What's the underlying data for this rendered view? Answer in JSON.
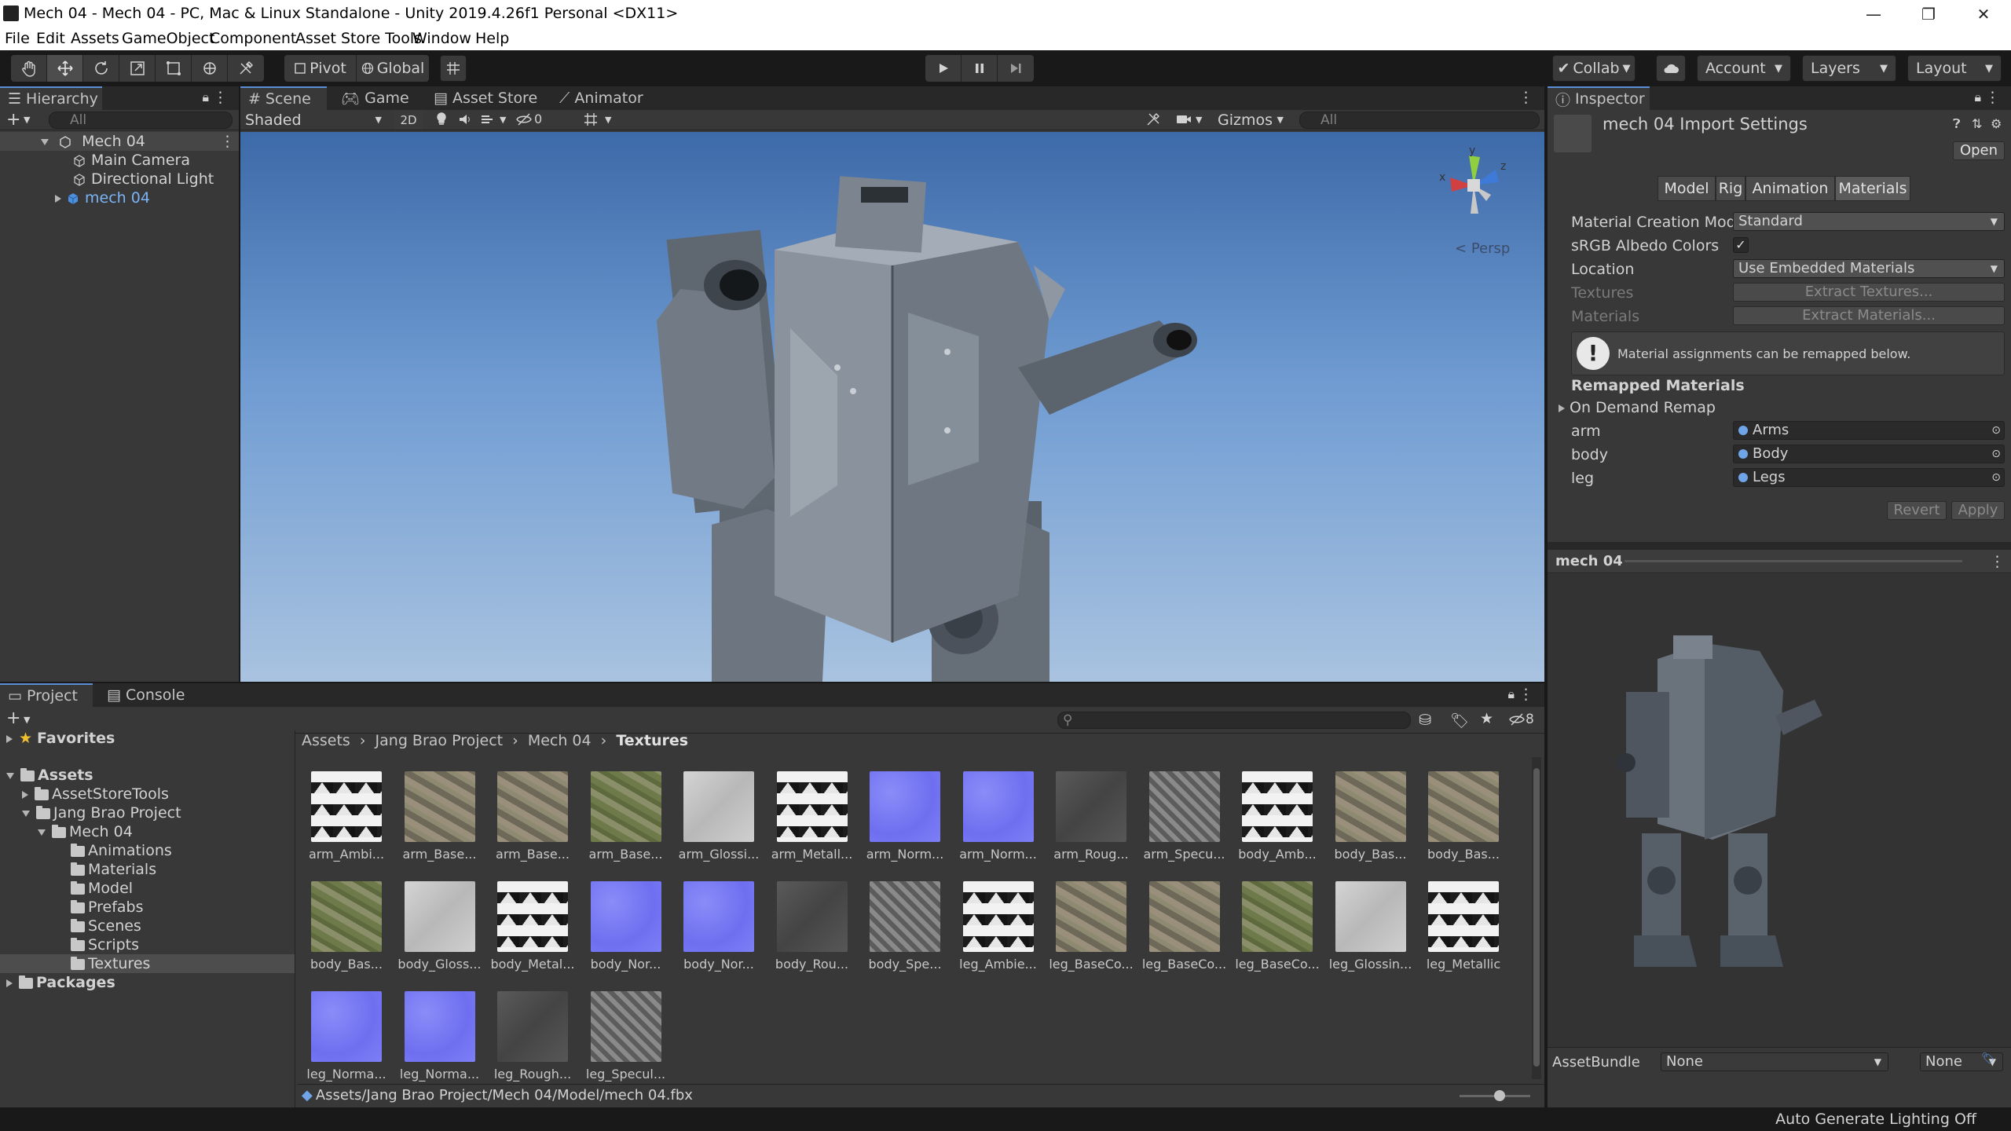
{
  "window": {
    "title": "Mech 04 - Mech 04 - PC, Mac & Linux Standalone - Unity 2019.4.26f1 Personal <DX11>",
    "minimize": "—",
    "maximize": "❐",
    "close": "✕"
  },
  "menu": [
    "File",
    "Edit",
    "Assets",
    "GameObject",
    "Component",
    "Asset Store Tools",
    "Window",
    "Help"
  ],
  "toolbar": {
    "pivot": "Pivot",
    "global": "Global",
    "collab": "Collab",
    "account": "Account",
    "layers": "Layers",
    "layout": "Layout"
  },
  "hierarchy": {
    "tab": "Hierarchy",
    "search_placeholder": "All",
    "scene": "Mech 04",
    "items": [
      "Main Camera",
      "Directional Light",
      "mech 04"
    ]
  },
  "scene_view": {
    "tabs": [
      "Scene",
      "Game",
      "Asset Store",
      "Animator"
    ],
    "shading": "Shaded",
    "mode_2d": "2D",
    "hidden_count": "0",
    "gizmos": "Gizmos",
    "search_placeholder": "All",
    "persp": "Persp",
    "axis_x": "x",
    "axis_y": "y",
    "axis_z": "z"
  },
  "inspector": {
    "tab": "Inspector",
    "title": "mech 04 Import Settings",
    "open_button": "Open",
    "tabs": [
      "Model",
      "Rig",
      "Animation",
      "Materials"
    ],
    "active_tab": "Materials",
    "fields": {
      "material_creation_mode_label": "Material Creation Mode",
      "material_creation_mode_value": "Standard",
      "srgb_label": "sRGB Albedo Colors",
      "srgb_checked": true,
      "location_label": "Location",
      "location_value": "Use Embedded Materials",
      "textures_label": "Textures",
      "extract_textures": "Extract Textures...",
      "materials_label": "Materials",
      "extract_materials": "Extract Materials..."
    },
    "info_message": "Material assignments can be remapped below.",
    "remapped_header": "Remapped Materials",
    "on_demand_remap": "On Demand Remap",
    "remaps": [
      {
        "name": "arm",
        "value": "Arms"
      },
      {
        "name": "body",
        "value": "Body"
      },
      {
        "name": "leg",
        "value": "Legs"
      }
    ],
    "revert": "Revert",
    "apply": "Apply",
    "preview_title": "mech 04",
    "assetbundle_label": "AssetBundle",
    "assetbundle_value": "None",
    "assetbundle_variant": "None"
  },
  "project": {
    "tabs": [
      "Project",
      "Console"
    ],
    "hidden_count": "8",
    "tree": {
      "favorites": "Favorites",
      "assets": "Assets",
      "assetstoretools": "AssetStoreTools",
      "jang_brao": "Jang Brao Project",
      "mech04": "Mech 04",
      "subfolders": [
        "Animations",
        "Materials",
        "Model",
        "Prefabs",
        "Scenes",
        "Scripts",
        "Textures"
      ],
      "packages": "Packages"
    },
    "breadcrumb": [
      "Assets",
      "Jang Brao Project",
      "Mech 04",
      "Textures"
    ],
    "files": [
      "arm_Ambi...",
      "arm_Base...",
      "arm_Base...",
      "arm_Base...",
      "arm_Glossi...",
      "arm_Metall...",
      "arm_Norm...",
      "arm_Norm...",
      "arm_Roug...",
      "arm_Specu...",
      "body_Amb...",
      "body_Bas...",
      "body_Bas...",
      "body_Bas...",
      "body_Gloss...",
      "body_Metal...",
      "body_Nor...",
      "body_Nor...",
      "body_Rou...",
      "body_Spe...",
      "leg_Ambie...",
      "leg_BaseCo...",
      "leg_BaseCo...",
      "leg_BaseCo...",
      "leg_Glossin...",
      "leg_Metallic",
      "leg_Norma...",
      "leg_Norma...",
      "leg_Rough...",
      "leg_Specul..."
    ],
    "status_path": "Assets/Jang Brao Project/Mech 04/Model/mech 04.fbx"
  },
  "statusbar": {
    "text": "Auto Generate Lighting Off"
  },
  "colors": {
    "accent": "#5a8fd6",
    "panel": "#383838",
    "dark": "#282828",
    "selection": "#2c5d87"
  }
}
